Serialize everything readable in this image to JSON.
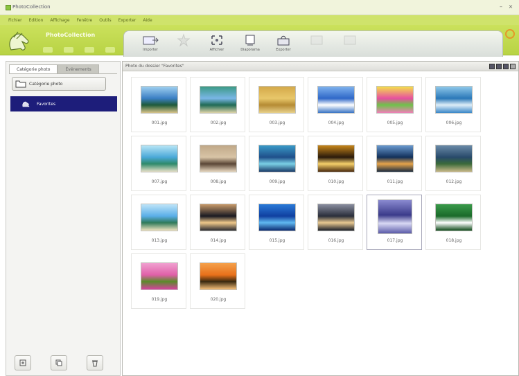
{
  "window": {
    "title": "PhotoCollection"
  },
  "menu": [
    "Fichier",
    "Edition",
    "Affichage",
    "Fenêtre",
    "Outils",
    "Exporter",
    "Aide"
  ],
  "brand": "PhotoCollection",
  "toolbar": [
    {
      "label": "Importer",
      "icon": "import-icon",
      "dim": false
    },
    {
      "label": "",
      "icon": "star-icon",
      "dim": true
    },
    {
      "label": "Affichier",
      "icon": "fullscreen-icon",
      "dim": false
    },
    {
      "label": "Diaporama",
      "icon": "slideshow-icon",
      "dim": false
    },
    {
      "label": "Exporter",
      "icon": "export-icon",
      "dim": false
    },
    {
      "label": "",
      "icon": "blank-icon",
      "dim": true
    },
    {
      "label": "",
      "icon": "blank-icon",
      "dim": true
    }
  ],
  "left": {
    "tabs": [
      "Catégorie photo",
      "Événements"
    ],
    "category_button": "Catégorie photo",
    "favorites": "Favorites"
  },
  "header": {
    "text": "Photo du dossier \"Favorites\""
  },
  "thumbnails": [
    {
      "label": "001.jpg",
      "colors": [
        "#3b7fc4",
        "#9fd0f0",
        "#1e5a3a",
        "#d7c28a"
      ]
    },
    {
      "label": "002.jpg",
      "colors": [
        "#7ab6e6",
        "#3c9a86",
        "#1f6a55",
        "#dcd2a8"
      ]
    },
    {
      "label": "003.jpg",
      "colors": [
        "#e8c76a",
        "#d4a94a",
        "#b58b34",
        "#e7d08a"
      ]
    },
    {
      "label": "004.jpg",
      "colors": [
        "#2f68c8",
        "#7fb2ee",
        "#ffffff",
        "#3a74c4"
      ]
    },
    {
      "label": "005.jpg",
      "colors": [
        "#e74fa0",
        "#f4e04c",
        "#6fc24a",
        "#ef7fb8"
      ]
    },
    {
      "label": "006.jpg",
      "colors": [
        "#2a78b8",
        "#8fc8ea",
        "#dfeef8",
        "#3a88c8"
      ]
    },
    {
      "label": "007.jpg",
      "colors": [
        "#4aa8d8",
        "#b8e6f6",
        "#2f8a6a",
        "#e6e0c8"
      ]
    },
    {
      "label": "008.jpg",
      "colors": [
        "#d8c4a6",
        "#c0a888",
        "#5a4636",
        "#e8d8c0"
      ]
    },
    {
      "label": "009.jpg",
      "colors": [
        "#1f4f8a",
        "#3a9ac8",
        "#7ad0e6",
        "#1a3a68"
      ]
    },
    {
      "label": "010.jpg",
      "colors": [
        "#2a1a0c",
        "#c8861a",
        "#f6d06a",
        "#4a2a0e"
      ]
    },
    {
      "label": "011.jpg",
      "colors": [
        "#12305a",
        "#6a9ad0",
        "#e6a44a",
        "#1a2a40"
      ]
    },
    {
      "label": "012.jpg",
      "colors": [
        "#284a6a",
        "#6a8aa8",
        "#3a6a3a",
        "#c8b888"
      ]
    },
    {
      "label": "013.jpg",
      "colors": [
        "#5aaee8",
        "#bfe4f8",
        "#2f7a5a",
        "#f0e4c0"
      ]
    },
    {
      "label": "014.jpg",
      "colors": [
        "#1a1a22",
        "#c89a6a",
        "#f0c88a",
        "#2a2a30"
      ]
    },
    {
      "label": "015.jpg",
      "colors": [
        "#1040a0",
        "#2a7ad8",
        "#60b8f0",
        "#0a2a70"
      ]
    },
    {
      "label": "016.jpg",
      "colors": [
        "#2a2e3a",
        "#8a8ea0",
        "#e8c890",
        "#1a1e28"
      ]
    },
    {
      "label": "017.jpg",
      "colors": [
        "#3a3a8a",
        "#8a8ad0",
        "#d8d8f4",
        "#5a5aa8"
      ]
    },
    {
      "label": "018.jpg",
      "colors": [
        "#1a6a2a",
        "#3a9a4a",
        "#ffffff",
        "#0e4a1a"
      ]
    },
    {
      "label": "019.jpg",
      "colors": [
        "#e060a8",
        "#f0a0d0",
        "#5a8a2a",
        "#d840a0"
      ]
    },
    {
      "label": "020.jpg",
      "colors": [
        "#e8701a",
        "#f4a04a",
        "#3a2a10",
        "#f6c07a"
      ]
    }
  ]
}
